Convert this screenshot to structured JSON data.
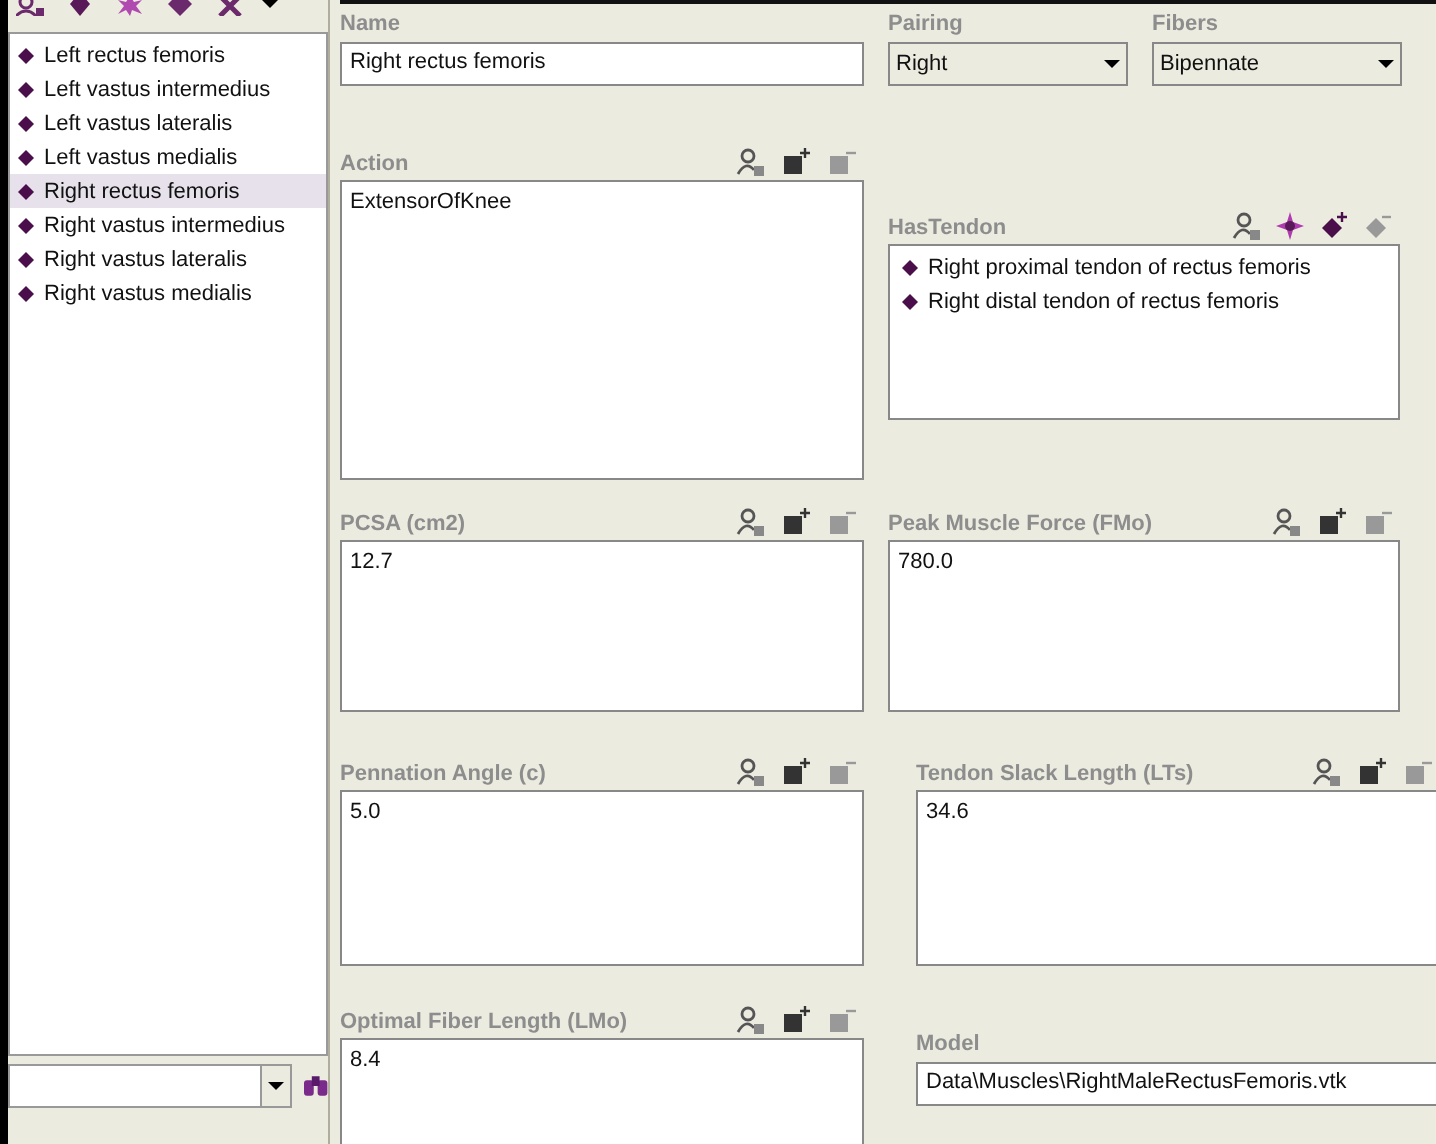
{
  "muscles": [
    {
      "label": "Left rectus femoris",
      "selected": false
    },
    {
      "label": "Left vastus intermedius",
      "selected": false
    },
    {
      "label": "Left vastus lateralis",
      "selected": false
    },
    {
      "label": "Left vastus medialis",
      "selected": false
    },
    {
      "label": "Right rectus femoris",
      "selected": true
    },
    {
      "label": "Right vastus intermedius",
      "selected": false
    },
    {
      "label": "Right vastus lateralis",
      "selected": false
    },
    {
      "label": "Right vastus medialis",
      "selected": false
    }
  ],
  "form": {
    "name": {
      "label": "Name",
      "value": "Right rectus femoris"
    },
    "pairing": {
      "label": "Pairing",
      "value": "Right"
    },
    "fibers": {
      "label": "Fibers",
      "value": "Bipennate"
    },
    "action": {
      "label": "Action",
      "values": [
        "ExtensorOfKnee"
      ]
    },
    "has_tendon": {
      "label": "HasTendon",
      "items": [
        "Right proximal tendon of rectus femoris",
        "Right distal tendon of rectus femoris"
      ]
    },
    "pcsa": {
      "label": "PCSA (cm2)",
      "values": [
        "12.7"
      ]
    },
    "peak_force": {
      "label": "Peak Muscle Force (FMo)",
      "values": [
        "780.0"
      ]
    },
    "pennation_angle": {
      "label": "Pennation Angle (c)",
      "values": [
        "5.0"
      ]
    },
    "tendon_slack_length": {
      "label": "Tendon Slack Length (LTs)",
      "values": [
        "34.6"
      ]
    },
    "optimal_fiber_length": {
      "label": "Optimal Fiber Length (LMo)",
      "values": [
        "8.4"
      ]
    },
    "model": {
      "label": "Model",
      "value": "Data\\Muscles\\RightMaleRectusFemoris.vtk"
    }
  }
}
